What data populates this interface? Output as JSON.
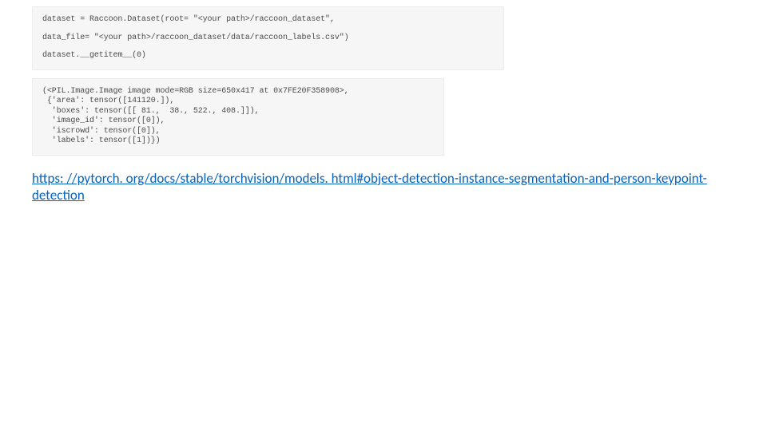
{
  "code_input": {
    "line1": "dataset = Raccoon.Dataset(root= \"<your path>/raccoon_dataset\",",
    "line2": "data_file= \"<your path>/raccoon_dataset/data/raccoon_labels.csv\")",
    "line3": "dataset.__getitem__(0)"
  },
  "code_output": {
    "line1": "(<PIL.Image.Image image mode=RGB size=650x417 at 0x7FE20F358908>,",
    "line2": " {'area': tensor([141120.]),",
    "line3": "  'boxes': tensor([[ 81.,  38., 522., 408.]]),",
    "line4": "  'image_id': tensor([0]),",
    "line5": "  'iscrowd': tensor([0]),",
    "line6": "  'labels': tensor([1])})"
  },
  "link": {
    "text": "https: //pytorch. org/docs/stable/torchvision/models. html#object-detection-instance-segmentation-and-person-keypoint-detection",
    "href": "https://pytorch.org/docs/stable/torchvision/models.html#object-detection-instance-segmentation-and-person-keypoint-detection"
  }
}
